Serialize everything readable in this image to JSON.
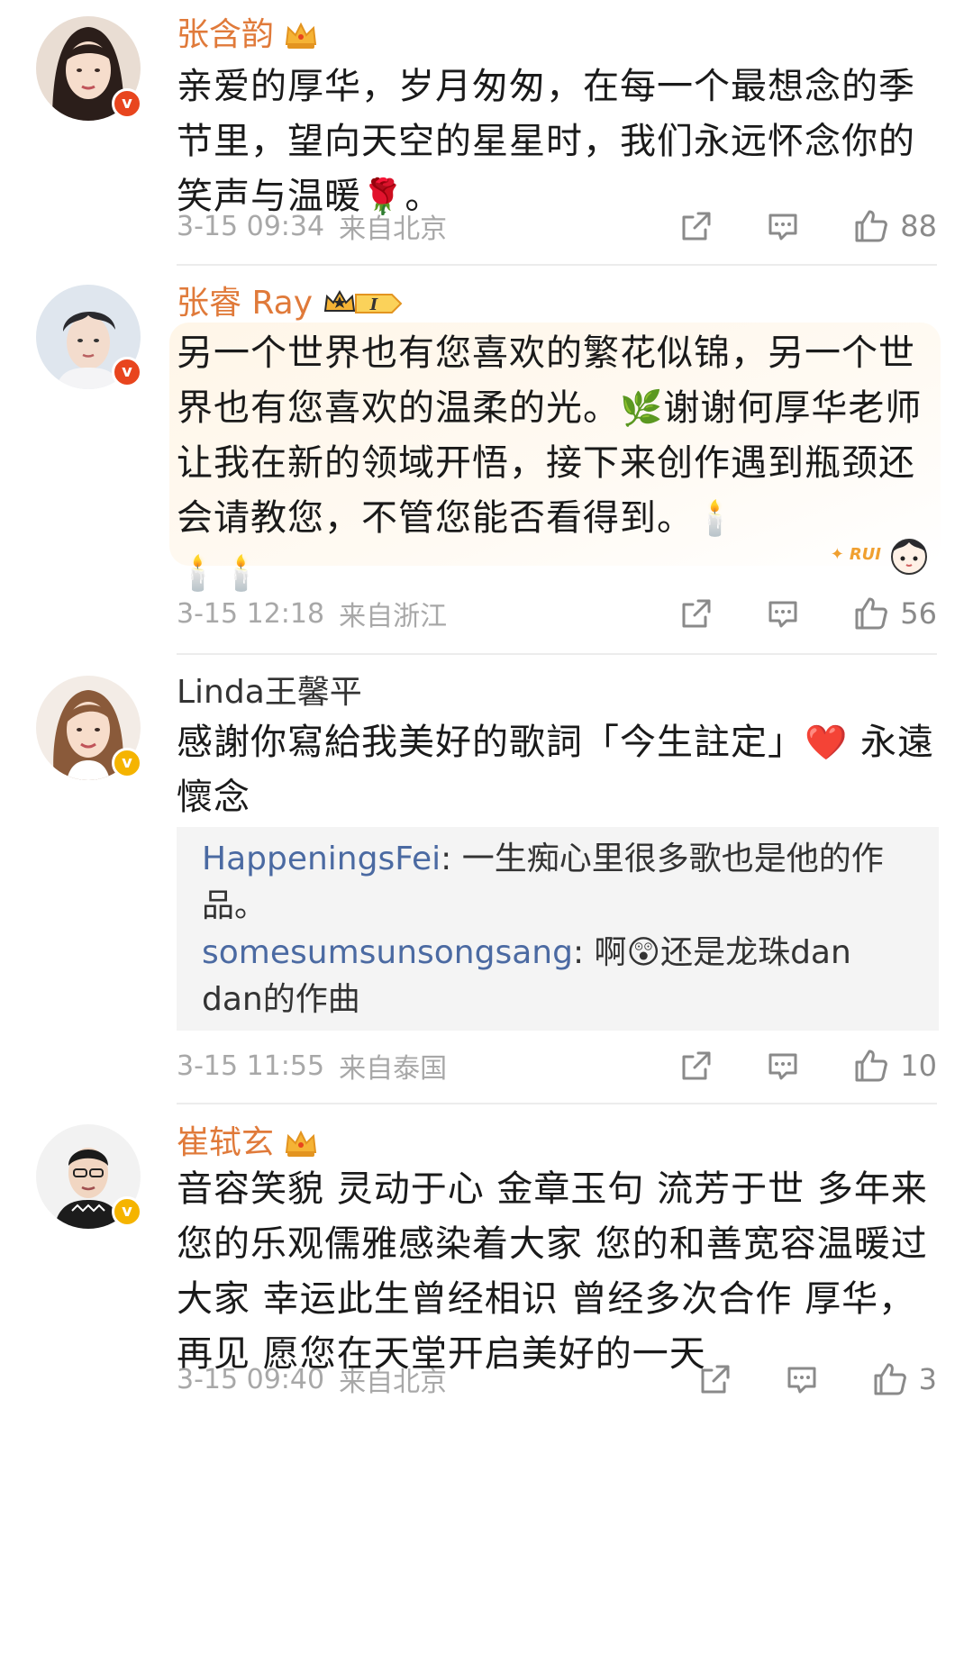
{
  "colors": {
    "vip_name": "#e07a3a",
    "normal_name": "#333333",
    "verified_red": "#e8451e",
    "verified_gold": "#f5b400",
    "meta_gray": "#a8a8a8",
    "reply_name": "#4b6aa2"
  },
  "comments": [
    {
      "username": "张含韵",
      "badge": "crown-icon",
      "verified": "red",
      "text": "亲爱的厚华，岁月匆匆，在每一个最想念的季节里，望向天空的星星时，我们永远怀念你的笑声与温暖",
      "text_emoji": "🌹",
      "text_end": "。",
      "time": "3-15 09:34",
      "location": "来自北京",
      "likes": "88"
    },
    {
      "username": "张睿 Ray",
      "badge": "vip-level-icon",
      "badge_level": "I",
      "verified": "red",
      "text_1": "另一个世界也有您喜欢的繁花似锦，另一个世界也有您喜欢的温柔的光。",
      "emoji_1": "🌿",
      "text_2": "谢谢何厚华老师让我在新的领域开悟，接下来创作遇到瓶颈还会请教您，不管您能否看得到。",
      "emoji_2": "🕯️",
      "emoji_3": "🕯️🕯️",
      "deco_label": "RUI",
      "time": "3-15 12:18",
      "location": "来自浙江",
      "likes": "56"
    },
    {
      "username": "Linda王馨平",
      "verified": "gold",
      "text_1": "感謝你寫給我美好的歌詞「今生註定」",
      "emoji_1": "❤️",
      "text_2": "永遠懷念",
      "replies": [
        {
          "name": "HappeningsFei",
          "text": ": 一生痴心里很多歌也是他的作品。"
        },
        {
          "name": "somesumsunsongsang",
          "text_pre": ": 啊",
          "emoji": "😲",
          "text_post": "还是龙珠dan dan的作曲"
        }
      ],
      "time": "3-15 11:55",
      "location": "来自泰国",
      "likes": "10"
    },
    {
      "username": "崔轼玄",
      "badge": "crown-icon",
      "verified": "gold",
      "text": "音容笑貌 灵动于心 金章玉句 流芳于世 多年来 您的乐观儒雅感染着大家 您的和善宽容温暖过大家 幸运此生曾经相识 曾经多次合作 厚华，再见 愿您在天堂开启美好的一天",
      "time": "3-15 09:40",
      "location": "来自北京",
      "likes": "3"
    }
  ]
}
